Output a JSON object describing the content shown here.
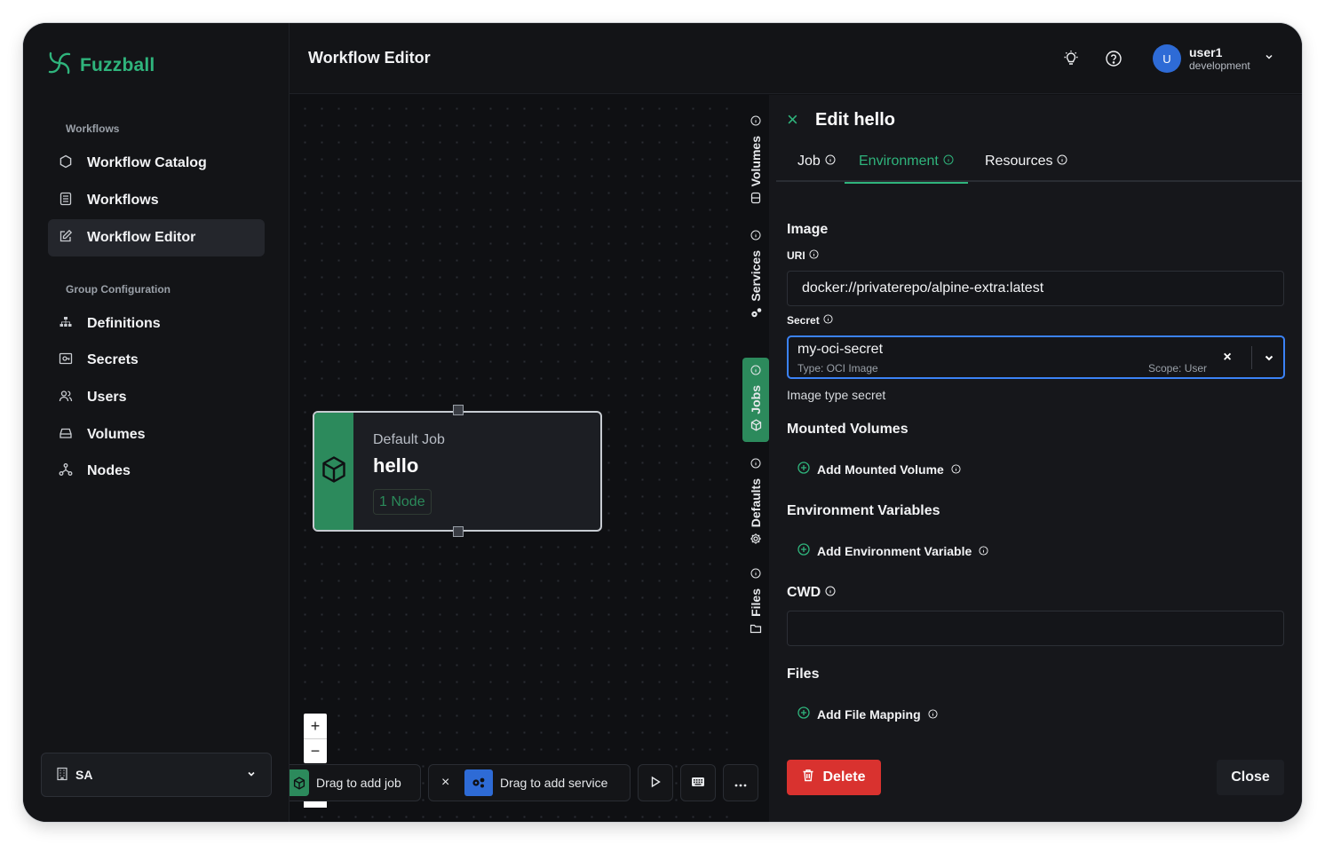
{
  "app": {
    "name": "Fuzzball",
    "brand_color": "#2fb47c",
    "accent": "#2c8a5c"
  },
  "sidebar": {
    "sections": [
      {
        "label": "Workflows"
      },
      {
        "label": "Group Configuration"
      }
    ],
    "items": [
      {
        "label": "Workflow Catalog",
        "icon": "hexagon-icon"
      },
      {
        "label": "Workflows",
        "icon": "list-icon"
      },
      {
        "label": "Workflow Editor",
        "icon": "edit-icon",
        "active": true
      },
      {
        "label": "Definitions",
        "icon": "sitemap-icon"
      },
      {
        "label": "Secrets",
        "icon": "key-icon"
      },
      {
        "label": "Users",
        "icon": "users-icon"
      },
      {
        "label": "Volumes",
        "icon": "drive-icon"
      },
      {
        "label": "Nodes",
        "icon": "nodes-icon"
      }
    ],
    "org_select": {
      "value": "SA"
    }
  },
  "header": {
    "title": "Workflow Editor",
    "user": {
      "avatar": "U",
      "name": "user1",
      "environment": "development"
    }
  },
  "canvas": {
    "node": {
      "subtitle": "Default Job",
      "title": "hello",
      "badge": "1 Node"
    },
    "zoom": {
      "in": "+",
      "out": "−"
    },
    "toolbar": {
      "add_job": "Drag to add job",
      "remove": "×",
      "add_service": "Drag to add service"
    }
  },
  "side_tabs": [
    {
      "label": "Volumes"
    },
    {
      "label": "Services"
    },
    {
      "label": "Jobs",
      "active": true
    },
    {
      "label": "Defaults"
    },
    {
      "label": "Files"
    }
  ],
  "panel": {
    "close_icon": "×",
    "title": "Edit hello",
    "tabs": [
      {
        "label": "Job"
      },
      {
        "label": "Environment",
        "active": true
      },
      {
        "label": "Resources"
      }
    ],
    "image": {
      "title": "Image",
      "uri_label": "URI",
      "uri_value": "docker://privaterepo/alpine-extra:latest",
      "secret_label": "Secret",
      "secret_value": "my-oci-secret",
      "secret_type": "Type: OCI Image",
      "secret_scope": "Scope: User",
      "secret_clear": "×",
      "helper": "Image type secret"
    },
    "mounted_volumes": {
      "title": "Mounted Volumes",
      "add": "Add Mounted Volume"
    },
    "env_vars": {
      "title": "Environment Variables",
      "add": "Add Environment Variable"
    },
    "cwd": {
      "title": "CWD",
      "value": ""
    },
    "files": {
      "title": "Files",
      "add": "Add File Mapping"
    },
    "delete": "Delete",
    "close": "Close"
  }
}
